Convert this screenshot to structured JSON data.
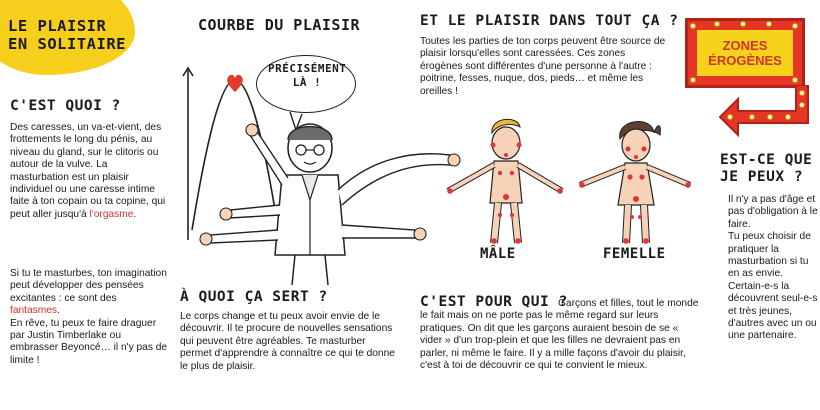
{
  "title": {
    "line1": "LE PLAISIR",
    "line2": "EN SOLITAIRE"
  },
  "section_what": {
    "heading": "C'EST QUOI ?",
    "text_before_link": "Des caresses, un va-et-vient, des frottements le long du pénis, au niveau du gland, sur le clitoris ou autour de la vulve. La masturbation est un plaisir individuel ou une caresse intime faite à ton copain ou ta copine, qui peut aller jusqu'à ",
    "link": "l'orgasme",
    "text_after_link": "."
  },
  "section_imagination": {
    "text_before": "Si tu te masturbes, ton imagination peut développer des pensées excitantes : ce sont des ",
    "link": "fantasmes",
    "text_after": ".",
    "text_2": "En rêve, tu peux te faire draguer par Justin Timberlake ou embrasser Beyoncé… il n'y pas de limite !"
  },
  "curve": {
    "title": "COURBE DU PLAISIR",
    "bubble": "PRÉCISÉMENT LÀ !"
  },
  "section_use": {
    "heading": "À QUOI ÇA SERT ?",
    "text": "Le corps change et tu peux avoir envie de le découvrir. Il te procure de nouvelles sensations qui peuvent être agréables. Te masturber permet d'apprendre à connaître ce qui te donne le plus de plaisir."
  },
  "section_everywhere": {
    "heading": "ET LE PLAISIR DANS TOUT ÇA ?",
    "text": "Toutes les parties de ton corps peuvent être source de plaisir lorsqu'elles sont caressées. Ces zones érogènes sont différentes d'une personne à l'autre : poitrine, fesses, nuque, dos, pieds… et même les oreilles !"
  },
  "figures": {
    "male": "MÂLE",
    "female": "FEMELLE"
  },
  "section_who": {
    "heading": "C'EST POUR QUI ?",
    "text": "Garçons et filles, tout le monde le fait mais on ne porte pas le même regard sur leurs pratiques. On dit que les garçons auraient besoin de se « vider » d'un trop-plein et que les filles ne devraient pas en parler, ni même le faire. Il y a mille façons d'avoir du plaisir, c'est à toi de découvrir ce qui te convient le mieux."
  },
  "sign": {
    "line1": "ZONES",
    "line2": "ÉROGÈNES"
  },
  "section_can": {
    "heading": "EST-CE QUE JE PEUX ?",
    "text_1": "Il n'y a pas d'âge et pas d'obligation à le faire.",
    "text_2": "Tu peux choisir de pratiquer la masturbation si tu en as envie. Certain-e-s la découvrent seul-e-s et très jeunes, d'autres avec un ou une partenaire."
  },
  "colors": {
    "yellow": "#f6cf1c",
    "red": "#d0332c",
    "sign_red": "#e53524"
  }
}
